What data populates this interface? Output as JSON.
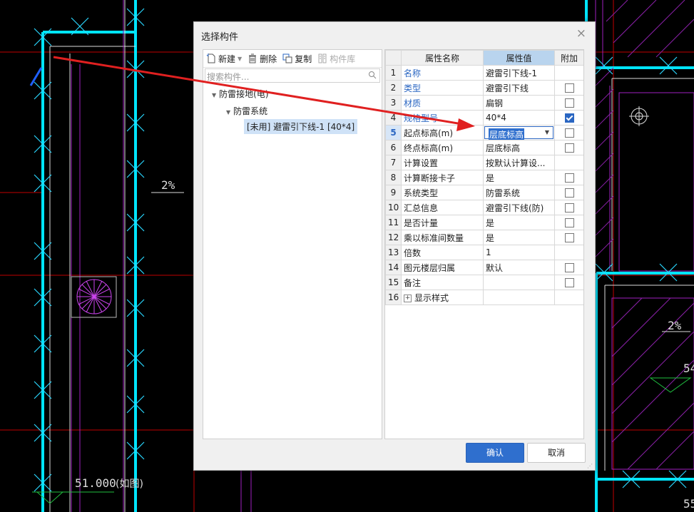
{
  "cad": {
    "labels": {
      "slope_left": "2%",
      "slope_right": "2%",
      "elevation": "51.000",
      "elevation_note": "(如图)",
      "right_num_1": "54",
      "right_num_2": "55"
    },
    "colors": {
      "background": "#000000",
      "wall": "#00e5ff",
      "cross": "#2ad8ff",
      "red_line": "#d10000",
      "magenta": "#a020c0",
      "arrow": "#e02020"
    }
  },
  "dialog": {
    "title": "选择构件",
    "close_glyph": "×",
    "toolbar": {
      "new": "新建",
      "delete": "删除",
      "copy": "复制",
      "library": "构件库"
    },
    "search_placeholder": "搜索构件...",
    "tree": [
      {
        "label": "防雷接地(电)",
        "level": 0
      },
      {
        "label": "防雷系统",
        "level": 1
      },
      {
        "label": "[未用] 避雷引下线-1 [40*4]",
        "level": 2,
        "selected": true
      }
    ],
    "props": {
      "headers": {
        "name": "属性名称",
        "value": "属性值",
        "extra": "附加"
      },
      "rows": [
        {
          "n": "1",
          "name": "名称",
          "value": "避雷引下线-1",
          "blue": true,
          "check": null
        },
        {
          "n": "2",
          "name": "类型",
          "value": "避雷引下线",
          "blue": true,
          "check": false
        },
        {
          "n": "3",
          "name": "材质",
          "value": "扁钢",
          "blue": true,
          "check": false
        },
        {
          "n": "4",
          "name": "规格型号",
          "value": "40*4",
          "blue": true,
          "check": true
        },
        {
          "n": "5",
          "name": "起点标高(m)",
          "value": "层底标高",
          "blue": false,
          "check": false,
          "editing": true
        },
        {
          "n": "6",
          "name": "终点标高(m)",
          "value": "层底标高",
          "blue": false,
          "check": false
        },
        {
          "n": "7",
          "name": "计算设置",
          "value": "按默认计算设...",
          "blue": false,
          "check": null
        },
        {
          "n": "8",
          "name": "计算断接卡子",
          "value": "是",
          "blue": false,
          "check": false
        },
        {
          "n": "9",
          "name": "系统类型",
          "value": "防雷系统",
          "blue": false,
          "check": false
        },
        {
          "n": "10",
          "name": "汇总信息",
          "value": "避雷引下线(防)",
          "blue": false,
          "check": false
        },
        {
          "n": "11",
          "name": "是否计量",
          "value": "是",
          "blue": false,
          "check": false
        },
        {
          "n": "12",
          "name": "乘以标准间数量",
          "value": "是",
          "blue": false,
          "check": false
        },
        {
          "n": "13",
          "name": "倍数",
          "value": "1",
          "blue": false,
          "check": null
        },
        {
          "n": "14",
          "name": "图元楼层归属",
          "value": "默认",
          "blue": false,
          "check": false
        },
        {
          "n": "15",
          "name": "备注",
          "value": "",
          "blue": false,
          "check": false
        },
        {
          "n": "16",
          "name": "显示样式",
          "value": "",
          "blue": false,
          "check": null,
          "expandable": true
        }
      ]
    },
    "buttons": {
      "ok": "确认",
      "cancel": "取消"
    }
  }
}
